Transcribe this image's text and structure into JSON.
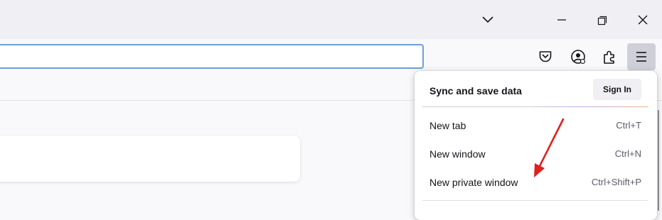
{
  "window_controls": {
    "list_tabs_icon": "chevron-down-icon",
    "minimize_icon": "minimize-icon",
    "restore_icon": "restore-icon",
    "close_icon": "close-icon"
  },
  "toolbar": {
    "url_value": "",
    "icons": [
      "pocket-icon",
      "account-icon",
      "extensions-icon",
      "hamburger-menu-icon"
    ]
  },
  "app_menu": {
    "sync_title": "Sync and save data",
    "sign_in_label": "Sign In",
    "items": [
      {
        "label": "New tab",
        "shortcut": "Ctrl+T"
      },
      {
        "label": "New window",
        "shortcut": "Ctrl+N"
      },
      {
        "label": "New private window",
        "shortcut": "Ctrl+Shift+P"
      }
    ]
  },
  "colors": {
    "annotation_arrow": "#e0201b",
    "urlbar_focus": "#6e9fd0",
    "menu_button_active": "#cfcfd8"
  }
}
